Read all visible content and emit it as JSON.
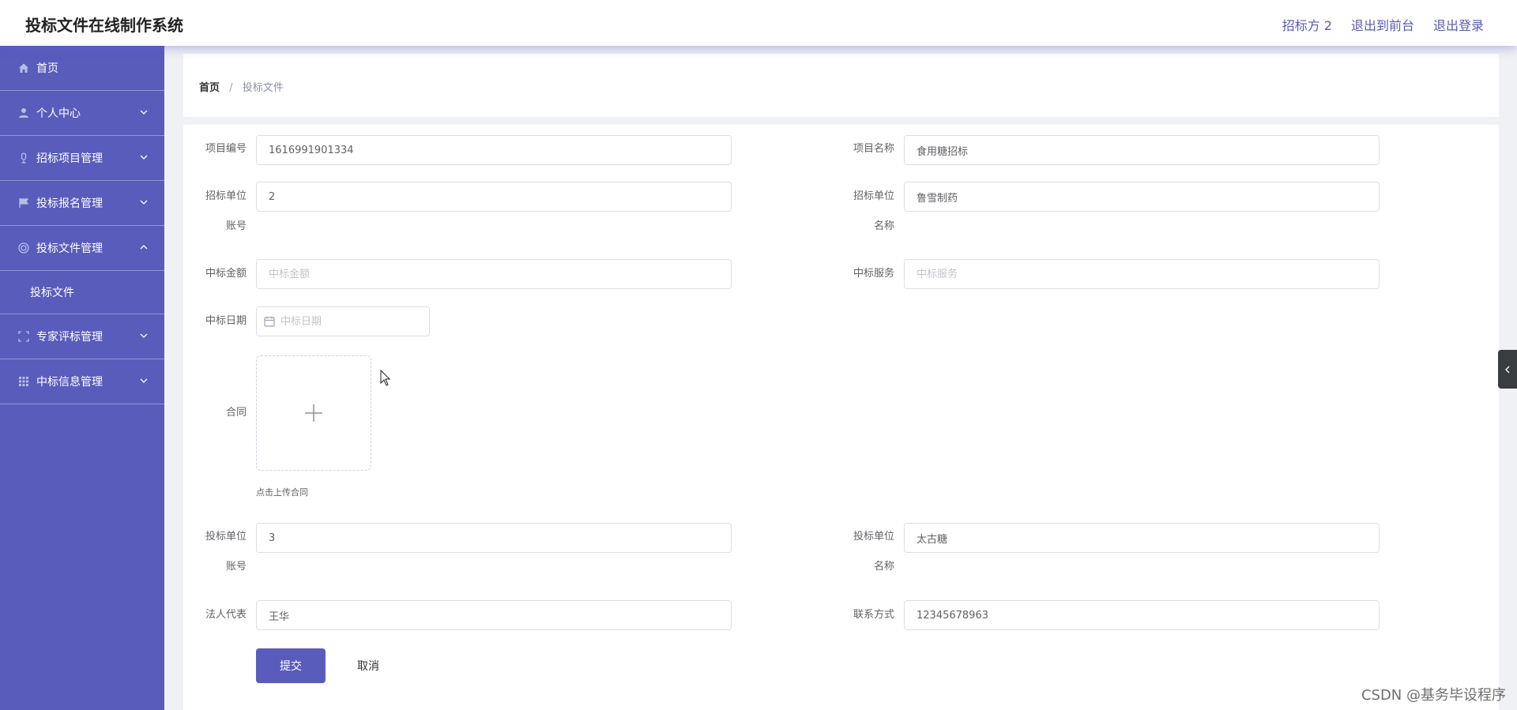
{
  "app": {
    "title": "投标文件在线制作系统",
    "user": "招标方 2",
    "back_to_front": "退出到前台",
    "logout": "退出登录"
  },
  "colors": {
    "accent": "#5a5cbc",
    "sidebar_bg": "#5a5cbc"
  },
  "sidebar": {
    "items": [
      {
        "label": "首页",
        "icon": "home-icon"
      },
      {
        "label": "个人中心",
        "icon": "user-icon"
      },
      {
        "label": "招标项目管理",
        "icon": "mic-icon"
      },
      {
        "label": "投标报名管理",
        "icon": "flag-icon"
      },
      {
        "label": "投标文件管理",
        "icon": "circle-icon",
        "expanded": true
      },
      {
        "label": "专家评标管理",
        "icon": "frame-icon"
      },
      {
        "label": "中标信息管理",
        "icon": "grid-icon"
      }
    ],
    "sub_item": "投标文件"
  },
  "breadcrumb": {
    "home": "首页",
    "sep": "/",
    "current": "投标文件"
  },
  "form": {
    "project_no": {
      "label": "项目编号",
      "value": "1616991901334"
    },
    "project_name": {
      "label": "项目名称",
      "value": "食用糖招标"
    },
    "tender_account": {
      "label1": "招标单位",
      "label2": "账号",
      "value": "2"
    },
    "tender_name": {
      "label1": "招标单位",
      "label2": "名称",
      "value": "鲁雪制药"
    },
    "win_amount": {
      "label": "中标金额",
      "placeholder": "中标金额"
    },
    "win_service": {
      "label": "中标服务",
      "placeholder": "中标服务"
    },
    "win_date": {
      "label": "中标日期",
      "placeholder": "中标日期"
    },
    "contract": {
      "label": "合同",
      "hint": "点击上传合同"
    },
    "bid_account": {
      "label1": "投标单位",
      "label2": "账号",
      "value": "3"
    },
    "bid_name": {
      "label1": "投标单位",
      "label2": "名称",
      "value": "太古糖"
    },
    "legal_rep": {
      "label": "法人代表",
      "value": "王华"
    },
    "contact": {
      "label": "联系方式",
      "value": "12345678963"
    },
    "submit": "提交",
    "cancel": "取消"
  },
  "watermark": "CSDN @基务毕设程序"
}
